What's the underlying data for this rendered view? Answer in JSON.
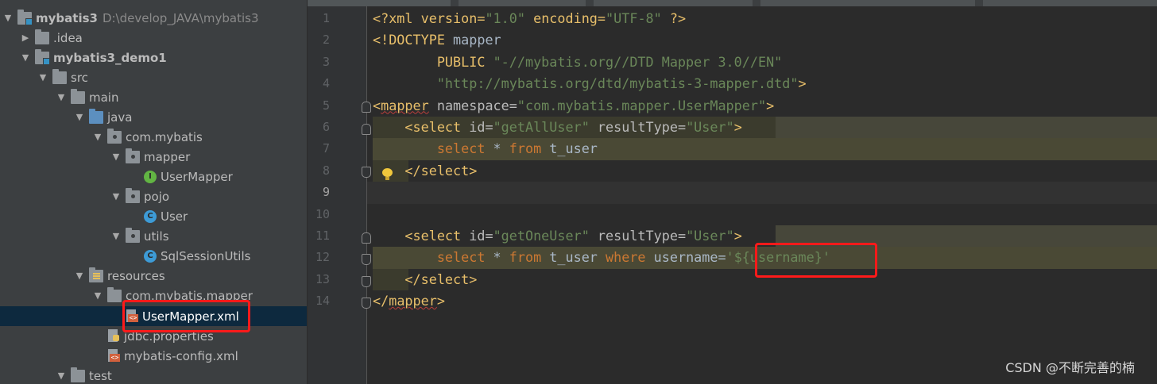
{
  "project_tree": {
    "root": {
      "name": "mybatis3",
      "path": "D:\\develop_JAVA\\mybatis3"
    },
    "items": [
      {
        "label": "mybatis3"
      },
      {
        "label": ".idea"
      },
      {
        "label": "mybatis3_demo1"
      },
      {
        "label": "src"
      },
      {
        "label": "main"
      },
      {
        "label": "java"
      },
      {
        "label": "com.mybatis"
      },
      {
        "label": "mapper"
      },
      {
        "label": "UserMapper"
      },
      {
        "label": "pojo"
      },
      {
        "label": "User"
      },
      {
        "label": "utils"
      },
      {
        "label": "SqlSessionUtils"
      },
      {
        "label": "resources"
      },
      {
        "label": "com.mybatis.mapper"
      },
      {
        "label": "UserMapper.xml"
      },
      {
        "label": "jdbc.properties"
      },
      {
        "label": "mybatis-config.xml"
      },
      {
        "label": "test"
      }
    ],
    "selected": "UserMapper.xml"
  },
  "editor": {
    "current_line": 9,
    "line_numbers": [
      "1",
      "2",
      "3",
      "4",
      "5",
      "6",
      "7",
      "8",
      "9",
      "10",
      "11",
      "12",
      "13",
      "14"
    ],
    "lines": {
      "l1": {
        "a": "<?xml version=",
        "b": "\"1.0\"",
        "c": " encoding=",
        "d": "\"UTF-8\"",
        "e": " ?>"
      },
      "l2": {
        "a": "<!DOCTYPE",
        "b": " mapper"
      },
      "l3": {
        "a": "        PUBLIC ",
        "b": "\"-//mybatis.org//DTD Mapper 3.0//EN\""
      },
      "l4": {
        "a": "        ",
        "b": "\"http://mybatis.org/dtd/mybatis-3-mapper.dtd\"",
        "c": ">"
      },
      "l5": {
        "a": "<",
        "b": "mapper",
        "c": " namespace=",
        "d": "\"com.mybatis.mapper.UserMapper\"",
        "e": ">"
      },
      "l6": {
        "a": "    <select ",
        "b": "id=",
        "c": "\"getAllUser\"",
        "d": " resultType=",
        "e": "\"User\"",
        "f": ">"
      },
      "l7": {
        "a": "        ",
        "b": "select",
        "c": " * ",
        "d": "from",
        "e": " t_user"
      },
      "l8": {
        "a": "    </select>"
      },
      "l11": {
        "a": "    <select ",
        "b": "id=",
        "c": "\"getOneUser\"",
        "d": " resultType=",
        "e": "\"User\"",
        "f": ">"
      },
      "l12": {
        "a": "        ",
        "b": "select",
        "c": " * ",
        "d": "from",
        "e": " t_user ",
        "f": "where",
        "g": " username=",
        "h": "'${username}'"
      },
      "l13": {
        "a": "    </select>"
      },
      "l14": {
        "a": "</",
        "b": "mapper",
        "c": ">"
      }
    }
  },
  "watermark": "CSDN @不断完善的楠",
  "colors": {
    "highlight_box": "#ff1a1a",
    "tag": "#e8bf6a",
    "string": "#6a8759",
    "keyword": "#cc7832"
  }
}
